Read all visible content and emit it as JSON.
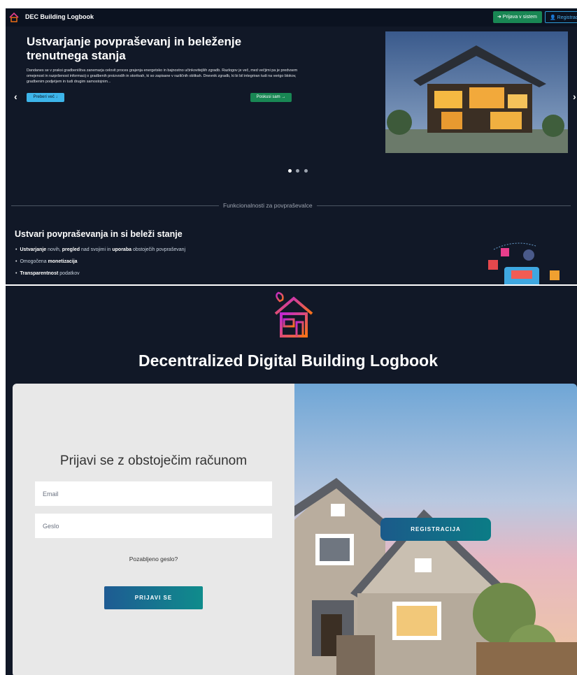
{
  "navbar": {
    "brand": "DEC Building Logbook",
    "login_button": "➜ Prijava v sistem",
    "register_button": "👤 Registracija"
  },
  "hero": {
    "title": "Ustvarjanje povpraševanj in beleženje trenutnega stanja",
    "text": "Dandanes se v praksi gradbeništva zanemarja celovit proces grajenja energetsko in bajnostno učinkovitejših zgradb. Razlogov je več, med večjimi pa je predvsem omejenost in razpršenost informacij o gradbenih proizvodih in storitvah, ki so zapisane v različnih oblikah. Dnevnik zgradb, ki bi bil integriran tudi na verigo blokov, gradbenim podjetjem in tudi drugim samostojnim...",
    "read_more": "Preberi več ↓",
    "try_it": "Poskusi sam →",
    "prev_arrow": "‹",
    "next_arrow": "›"
  },
  "features": {
    "divider_label": "Funkcionalnosti za povpraševalce",
    "title": "Ustvari povpraševanja in si beleži stanje",
    "items": [
      {
        "b1": "Ustvarjanje",
        "t1": " novih, ",
        "b2": "pregled",
        "t2": " nad svojimi in ",
        "b3": "uporaba",
        "t3": " obstoječih povpraševanj"
      },
      {
        "b1": "",
        "t1": "Omogočena ",
        "b2": "monetizacija",
        "t2": "",
        "b3": "",
        "t3": ""
      },
      {
        "b1": "Transparentnost",
        "t1": " podatkov",
        "b2": "",
        "t2": "",
        "b3": "",
        "t3": ""
      }
    ]
  },
  "login": {
    "page_title": "Decentralized Digital Building Logbook",
    "heading": "Prijavi se z obstoječim računom",
    "email_placeholder": "Email",
    "password_placeholder": "Geslo",
    "forgot": "Pozabljeno geslo?",
    "submit": "PRIJAVI SE",
    "register": "REGISTRACIJA"
  },
  "colors": {
    "dark_bg": "#111827",
    "navbar_bg": "#0b1220",
    "green": "#198754",
    "cyan": "#3db5ea",
    "teal_gradient_start": "#1e5b93",
    "teal_gradient_end": "#0f8c8c"
  },
  "icons": {
    "brand": "house-logo-icon",
    "login": "sign-in-icon",
    "register": "user-plus-icon"
  }
}
